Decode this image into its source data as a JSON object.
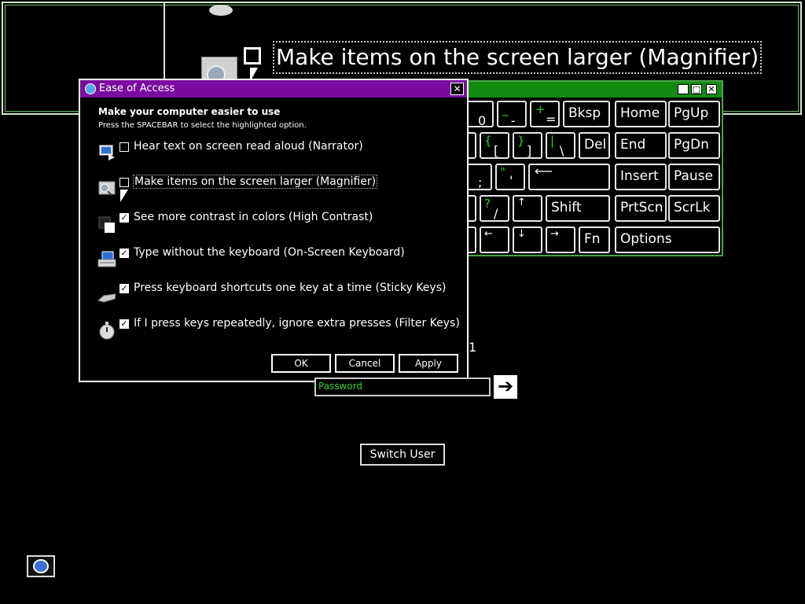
{
  "magnifier": {
    "option_text": "Make items on the screen larger (Magnifier)"
  },
  "keyboard": {
    "keys": {
      "r1_a": "0",
      "r1_b": "_",
      "r1_b2": "-",
      "r1_c": "+",
      "r1_c2": "=",
      "bksp": "Bksp",
      "home": "Home",
      "pgup": "PgUp",
      "r2_a": "{",
      "r2_a2": "[",
      "r2_b": "}",
      "r2_b2": "]",
      "r2_c": "|",
      "r2_c2": "\\",
      "del": "Del",
      "end": "End",
      "pgdn": "PgDn",
      "r3_a": ";",
      "r3_b": "\"",
      "r3_b2": "'",
      "insert": "Insert",
      "pause": "Pause",
      "r4_a": "?",
      "r4_a2": "/",
      "r4_b": "↑",
      "shift": "Shift",
      "prtscn": "PrtScn",
      "scrlk": "ScrLk",
      "left": "←",
      "down": "↓",
      "right": "→",
      "fn": "Fn",
      "options": "Options"
    }
  },
  "dialog": {
    "title": "Ease of Access",
    "heading": "Make your computer easier to use",
    "subheading": "Press the SPACEBAR to select the highlighted option.",
    "options": [
      {
        "label": "Hear text on screen read aloud (Narrator)",
        "checked": false,
        "icon": "narrator-icon"
      },
      {
        "label": "Make items on the screen larger (Magnifier)",
        "checked": false,
        "icon": "magnifier-icon"
      },
      {
        "label": "See more contrast in colors (High Contrast)",
        "checked": true,
        "icon": "high-contrast-icon"
      },
      {
        "label": "Type without the keyboard (On-Screen Keyboard)",
        "checked": true,
        "icon": "keyboard-icon"
      },
      {
        "label": "Press keyboard shortcuts one key at a time (Sticky Keys)",
        "checked": true,
        "icon": "sticky-keys-icon"
      },
      {
        "label": "If I press keys repeatedly, ignore extra presses (Filter Keys)",
        "checked": true,
        "icon": "filter-keys-icon"
      }
    ],
    "ok": "OK",
    "cancel": "Cancel",
    "apply": "Apply",
    "close": "✕"
  },
  "logon": {
    "password_placeholder": "Password",
    "go": "➔",
    "switch_user": "Switch User",
    "stray_char": "1"
  },
  "colors": {
    "dialog_title": "#7a0aa0",
    "keyboard_title": "#118a11",
    "key_green": "#2ed12e"
  }
}
